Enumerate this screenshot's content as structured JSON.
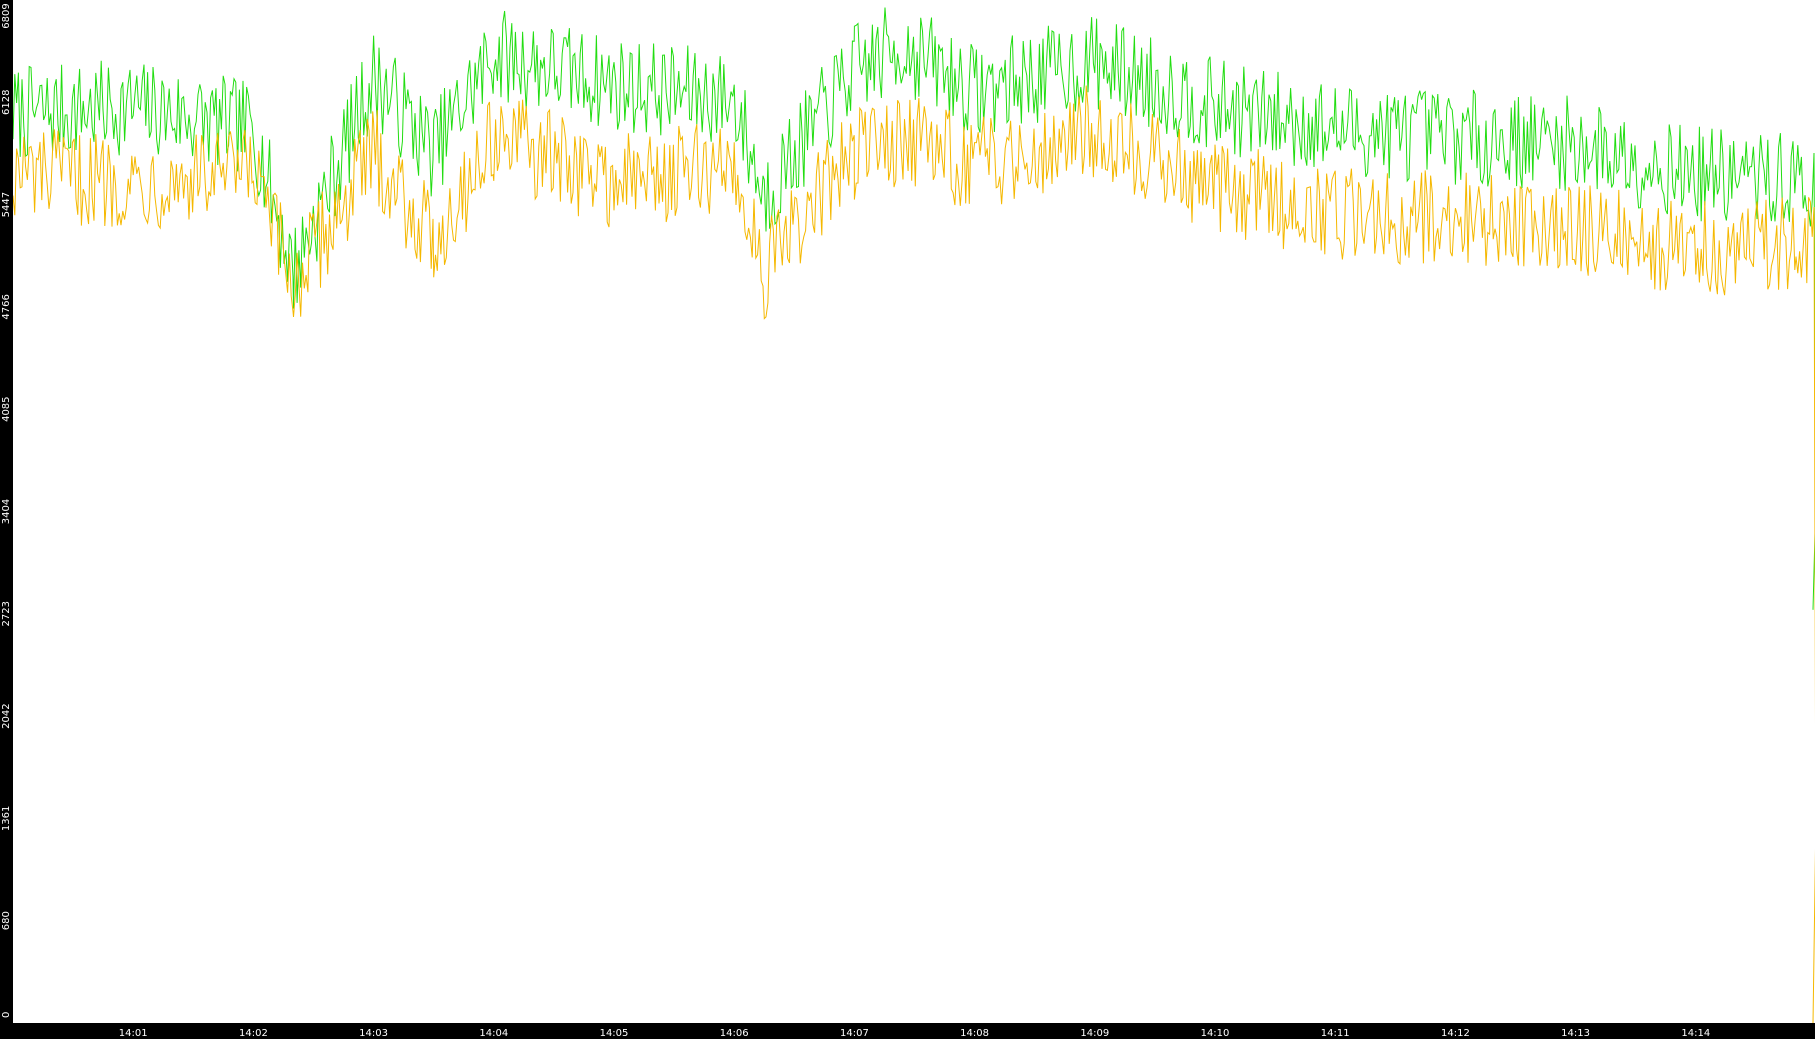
{
  "chart_data": {
    "type": "line",
    "title": "",
    "xlabel": "",
    "ylabel": "",
    "ylim": [
      0,
      6809
    ],
    "y_ticks": [
      "0",
      "680",
      "1361",
      "2042",
      "2723",
      "3404",
      "4085",
      "4766",
      "5447",
      "6128",
      "6809"
    ],
    "x_ticks": [
      "14:01",
      "14:02",
      "14:03",
      "14:04",
      "14:05",
      "14:06",
      "14:07",
      "14:08",
      "14:09",
      "14:10",
      "14:11",
      "14:12",
      "14:13",
      "14:14"
    ],
    "x_range": [
      "14:00",
      "14:15"
    ],
    "grid": false,
    "legend": "none",
    "background_color": "#ffffff",
    "axis_color": "#000000",
    "tick_label_color": "#ffffff",
    "series": [
      {
        "color": "#22dd11",
        "x": [
          "14:00",
          "14:01",
          "14:02",
          "14:02:20",
          "14:03",
          "14:03:30",
          "14:04",
          "14:05",
          "14:06",
          "14:06:15",
          "14:07",
          "14:07:25",
          "14:08",
          "14:09",
          "14:10",
          "14:11",
          "14:12",
          "14:13",
          "14:14",
          "14:14:50",
          "14:15"
        ],
        "values": [
          6050,
          6100,
          5950,
          5000,
          6300,
          5800,
          6450,
          6250,
          6150,
          5500,
          6350,
          6500,
          6200,
          6400,
          6100,
          5950,
          5900,
          5850,
          5650,
          5600,
          2750
        ]
      },
      {
        "color": "#f5b800",
        "x": [
          "14:00",
          "14:01",
          "14:02",
          "14:02:20",
          "14:03",
          "14:03:30",
          "14:04",
          "14:05",
          "14:06",
          "14:06:15",
          "14:07",
          "14:07:25",
          "14:08",
          "14:09",
          "14:10",
          "14:11",
          "14:12",
          "14:13",
          "14:14",
          "14:14:50",
          "14:15"
        ],
        "values": [
          5650,
          5600,
          5650,
          4900,
          5800,
          5200,
          5900,
          5600,
          5700,
          5000,
          5800,
          5900,
          5700,
          5950,
          5550,
          5400,
          5350,
          5300,
          5150,
          5200,
          0
        ]
      }
    ]
  }
}
